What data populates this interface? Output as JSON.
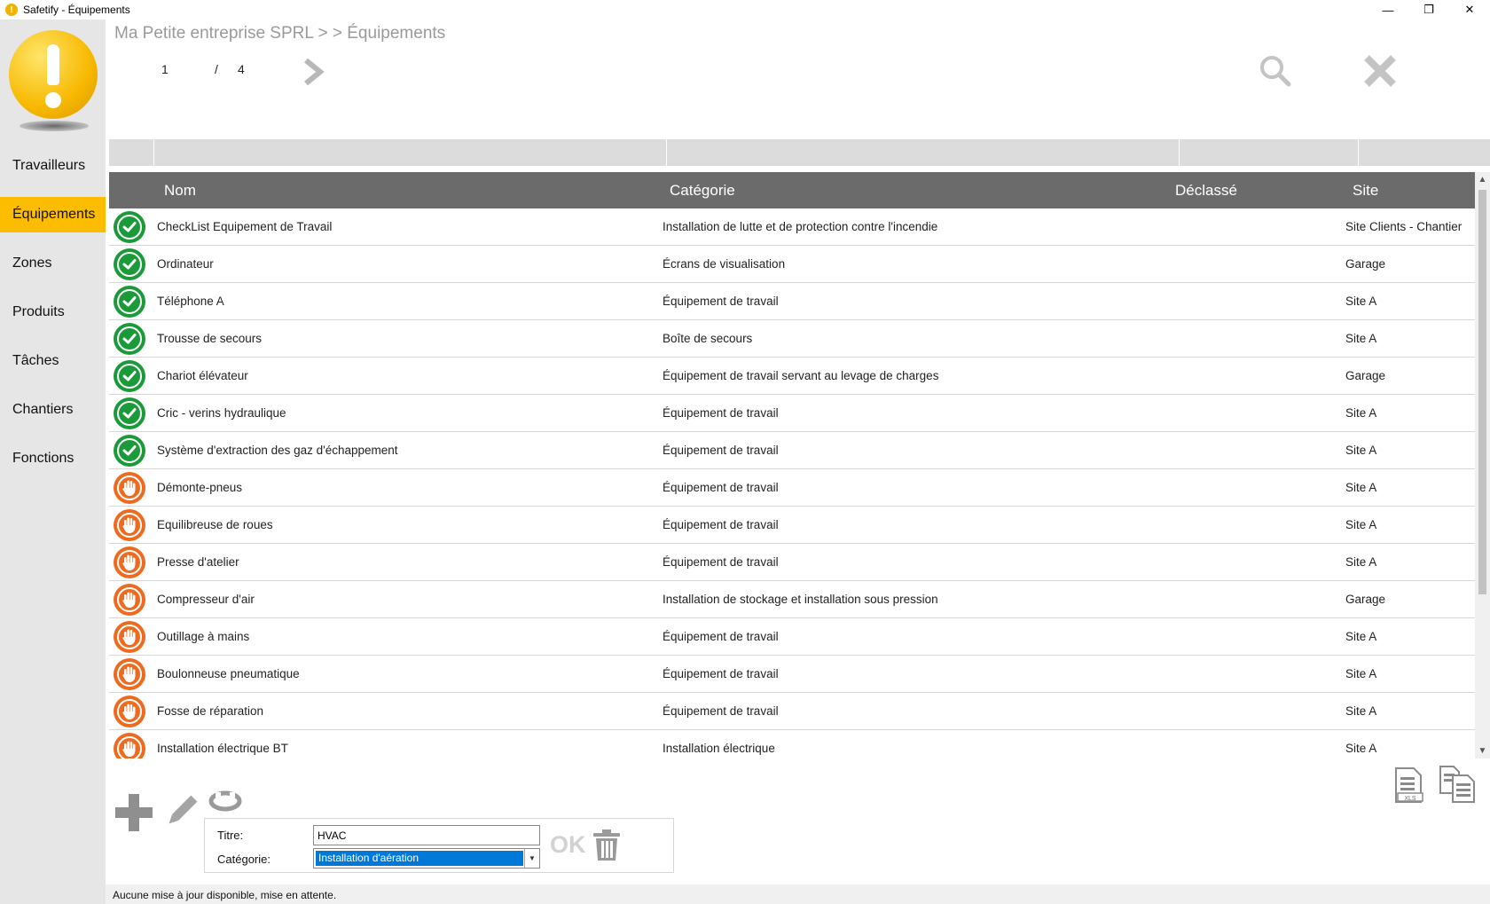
{
  "window": {
    "title": "Safetify - Équipements",
    "minimize": "—",
    "restore": "❐",
    "close": "✕"
  },
  "sidebar": {
    "items": [
      {
        "label": "Travailleurs",
        "active": false
      },
      {
        "label": "Équipements",
        "active": true
      },
      {
        "label": "Zones",
        "active": false
      },
      {
        "label": "Produits",
        "active": false
      },
      {
        "label": "Tâches",
        "active": false
      },
      {
        "label": "Chantiers",
        "active": false
      },
      {
        "label": "Fonctions",
        "active": false
      }
    ]
  },
  "header": {
    "breadcrumb": "Ma Petite entreprise SPRL > > Équipements",
    "page_current": "1",
    "page_sep": "/",
    "page_total": "4"
  },
  "table": {
    "columns": {
      "nom": "Nom",
      "categorie": "Catégorie",
      "declasse": "Déclassé",
      "site": "Site"
    },
    "rows": [
      {
        "status": "ok",
        "nom": "CheckList Equipement de Travail",
        "categorie": "Installation de lutte et de protection contre l'incendie",
        "site": "Site Clients - Chantier"
      },
      {
        "status": "ok",
        "nom": "Ordinateur",
        "categorie": "Écrans de visualisation",
        "site": "Garage"
      },
      {
        "status": "ok",
        "nom": "Téléphone A",
        "categorie": "Équipement de travail",
        "site": "Site A"
      },
      {
        "status": "ok",
        "nom": "Trousse de secours",
        "categorie": "Boîte de secours",
        "site": "Site A"
      },
      {
        "status": "ok",
        "nom": "Chariot élévateur",
        "categorie": "Équipement de travail servant au levage de charges",
        "site": "Garage"
      },
      {
        "status": "ok",
        "nom": "Cric - verins hydraulique",
        "categorie": "Équipement de travail",
        "site": "Site A"
      },
      {
        "status": "ok",
        "nom": "Système d'extraction des gaz d'échappement",
        "categorie": "Équipement de travail",
        "site": "Site A"
      },
      {
        "status": "stop",
        "nom": "Démonte-pneus",
        "categorie": "Équipement de travail",
        "site": "Site A"
      },
      {
        "status": "stop",
        "nom": "Equilibreuse de roues",
        "categorie": "Équipement de travail",
        "site": "Site A"
      },
      {
        "status": "stop",
        "nom": "Presse d'atelier",
        "categorie": "Équipement de travail",
        "site": "Site A"
      },
      {
        "status": "stop",
        "nom": "Compresseur d'air",
        "categorie": "Installation de stockage et installation sous pression",
        "site": "Garage"
      },
      {
        "status": "stop",
        "nom": "Outillage à mains",
        "categorie": "Équipement de travail",
        "site": "Site A"
      },
      {
        "status": "stop",
        "nom": "Boulonneuse pneumatique",
        "categorie": "Équipement de travail",
        "site": "Site A"
      },
      {
        "status": "stop",
        "nom": "Fosse de réparation",
        "categorie": "Équipement de travail",
        "site": "Site A"
      },
      {
        "status": "stop",
        "nom": "Installation électrique BT",
        "categorie": "Installation électrique",
        "site": "Site A"
      }
    ]
  },
  "editor": {
    "titre_label": "Titre:",
    "titre_value": "HVAC",
    "categorie_label": "Catégorie:",
    "categorie_value": "Installation d'aération",
    "ok_label": "OK"
  },
  "export": {
    "xls_label": "XLS"
  },
  "status_bar": "Aucune mise à jour disponible, mise en attente.",
  "colors": {
    "accent": "#fcbd00",
    "ok": "#1b9a3a",
    "stop": "#ee6a1e",
    "header": "#6b6b6b"
  },
  "icons": [
    "warning-logo-icon",
    "chevron-right-icon",
    "search-icon",
    "close-x-icon",
    "check-icon",
    "hand-stop-icon",
    "plus-icon",
    "pencil-icon",
    "lifebuoy-icon",
    "trash-icon",
    "xls-export-icon",
    "copy-documents-icon"
  ]
}
